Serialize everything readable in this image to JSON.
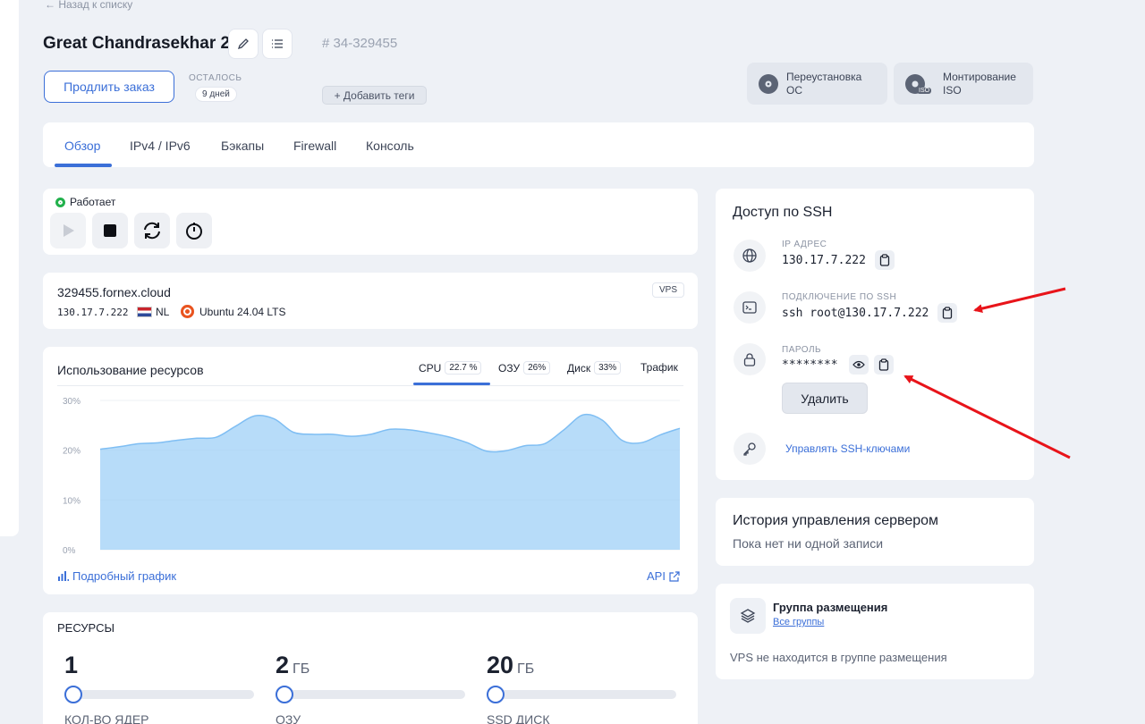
{
  "back_link": "← Назад к списку",
  "server": {
    "name": "Great Chandrasekhar 2",
    "id": "# 34-329455"
  },
  "order": {
    "extend_label": "Продлить заказ",
    "remaining_label": "ОСТАЛОСЬ",
    "remaining_value": "9 дней",
    "add_tags_label": "+ Добавить теги"
  },
  "actions": {
    "reinstall_line1": "Переустановка",
    "reinstall_line2": "ОС",
    "mount_line1": "Монтирование",
    "mount_line2": "ISO",
    "iso_badge": "ISO"
  },
  "tabs": [
    "Обзор",
    "IPv4 / IPv6",
    "Бэкапы",
    "Firewall",
    "Консоль"
  ],
  "status": {
    "label": "Работает",
    "color": "#22b14c"
  },
  "host": {
    "hostname": "329455.fornex.cloud",
    "ip": "130.17.7.222",
    "country": "NL",
    "os": "Ubuntu 24.04 LTS",
    "badge": "VPS"
  },
  "usage": {
    "title": "Использование ресурсов",
    "metrics": [
      {
        "label": "CPU",
        "value": "22.7 %"
      },
      {
        "label": "ОЗУ",
        "value": "26%"
      },
      {
        "label": "Диск",
        "value": "33%"
      },
      {
        "label": "Трафик",
        "value": ""
      }
    ],
    "detail_link": "Подробный график",
    "api_link": "API"
  },
  "chart_data": {
    "type": "area",
    "x": [
      0,
      1,
      2,
      3,
      4,
      5,
      6,
      7,
      8,
      9,
      10,
      11,
      12,
      13,
      14,
      15,
      16,
      17,
      18,
      19,
      20,
      21,
      22,
      23,
      24,
      25,
      26,
      27,
      28,
      29,
      30
    ],
    "values": [
      20.2,
      20.7,
      21.3,
      21.5,
      22,
      22.4,
      22.6,
      24.8,
      26.9,
      26.3,
      23.6,
      23.2,
      23.2,
      22.8,
      23.2,
      24.2,
      24.1,
      23.5,
      22.7,
      21.5,
      19.8,
      19.9,
      20.9,
      21.3,
      24.1,
      27.1,
      26.0,
      22.0,
      21.5,
      23.1,
      24.4
    ],
    "ylim": [
      0,
      30
    ],
    "yticks": [
      "30%",
      "20%",
      "10%",
      "0%"
    ],
    "color": "#9fd0f7",
    "grid": true
  },
  "resources": {
    "title": "РЕСУРСЫ",
    "items": [
      {
        "value": "1",
        "unit": "",
        "label": "КОЛ-ВО ЯДЕР"
      },
      {
        "value": "2",
        "unit": "ГБ",
        "label": "ОЗУ"
      },
      {
        "value": "20",
        "unit": "ГБ",
        "label": "SSD ДИСК"
      }
    ]
  },
  "ssh": {
    "title": "Доступ по SSH",
    "ip_label": "IP АДРЕС",
    "ip_value": "130.17.7.222",
    "conn_label": "ПОДКЛЮЧЕНИЕ ПО SSH",
    "conn_value": "ssh root@130.17.7.222",
    "password_label": "ПАРОЛЬ",
    "password_value": "********",
    "delete_label": "Удалить",
    "keys_link": "Управлять SSH-ключами"
  },
  "history": {
    "title": "История управления сервером",
    "empty": "Пока нет ни одной записи"
  },
  "placement": {
    "title": "Группа размещения",
    "link": "Все группы",
    "empty": "VPS не находится в группе размещения"
  },
  "accent_color": "#3b6fd8"
}
